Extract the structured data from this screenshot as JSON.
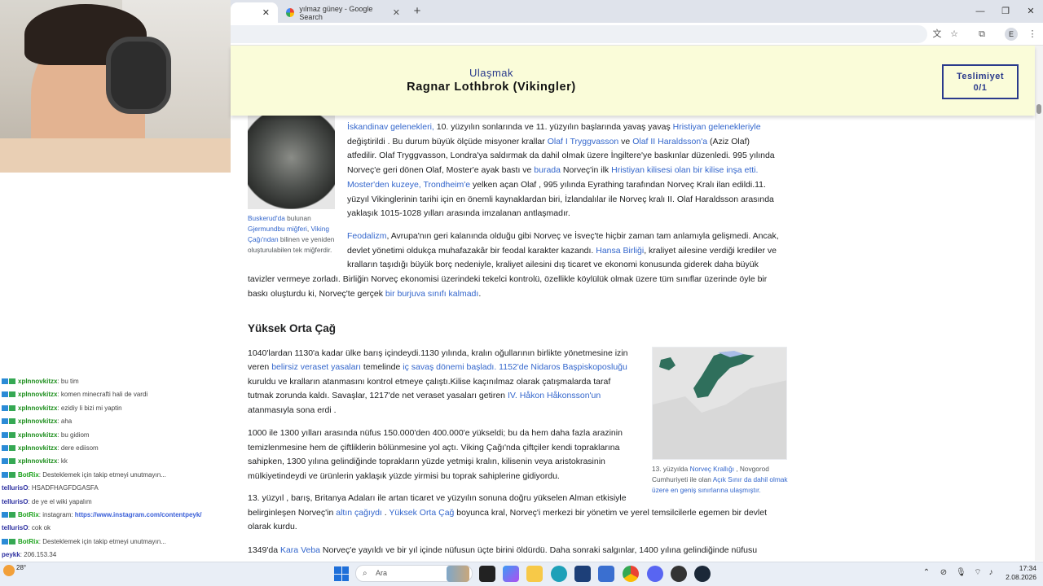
{
  "browser": {
    "tabs": [
      {
        "label": ""
      },
      {
        "label": "yılmaz güney - Google Search"
      }
    ],
    "new_tab_icon": "plus-icon",
    "window_controls": [
      "minimize-icon",
      "restore-icon",
      "close-icon"
    ],
    "toolbar_icons": [
      "translate-icon",
      "star-icon",
      "extensions-icon"
    ],
    "profile_initial": "E",
    "menu_icon": "kebab-menu-icon"
  },
  "game": {
    "goal_label": "Ulaşmak",
    "target_title": "Ragnar Lothbrok (Vikingler)",
    "submission_label": "Teslimiyet",
    "submission_count": "0/1"
  },
  "article": {
    "intro_lines": [
      [
        "",
        "İskandinav gelenekleri,",
        " 10. yüzyılın sonlarında ve 11. yüzyılın başlarında yavaş yavaş ",
        "Hristiyan gelenekleriyle"
      ],
      [
        "değiştirildi . Bu durum büyük ölçüde misyoner krallar ",
        "Olaf I Tryggvasson",
        " ve ",
        "Olaf II Haraldsson'a",
        " (Aziz Olaf)"
      ],
      [
        "atfedilir. Olaf Tryggvasson, Londra'ya saldırmak da dahil olmak üzere İngiltere'ye baskınlar düzenledi. 995 yılında"
      ],
      [
        "Norveç'e geri dönen Olaf, Moster'e ayak bastı ve ",
        "burada",
        " Norveç'in ilk ",
        "Hristiyan kilisesi olan bir kilise inşa etti."
      ],
      [
        "",
        "Moster'den kuzeye, Trondheim'e",
        " yelken açan Olaf , 995 yılında Eyrathing tarafından Norveç Kralı ilan edildi.11."
      ],
      [
        "yüzyıl Vikinglerinin tarihi için en önemli kaynaklardan biri, İzlandalılar ile Norveç kralı II. Olaf Haraldsson arasında"
      ],
      [
        "yaklaşık 1015-1028 yılları arasında imzalanan antlaşmadır."
      ]
    ],
    "helmet_caption": {
      "parts": [
        "Buskerud'da",
        " bulunan ",
        "Gjermundbu miğferi",
        ", ",
        "Viking Çağı'ndan",
        " bilinen ve yeniden oluşturulabilen tek miğferdir."
      ]
    },
    "feudal_lines": [
      [
        "",
        "Feodalizm",
        ", Avrupa'nın geri kalanında olduğu gibi Norveç ve İsveç'te hiçbir zaman tam anlamıyla gelişmedi. Ancak,"
      ],
      [
        "devlet yönetimi oldukça muhafazakâr bir feodal karakter kazandı. ",
        "Hansa Birliği",
        ", kraliyet ailesine verdiği krediler ve"
      ],
      [
        "kralların taşıdığı büyük borç nedeniyle, kraliyet ailesini dış ticaret ve ekonomi konusunda giderek daha büyük"
      ],
      [
        "tavizler vermeye zorladı. Birliğin Norveç ekonomisi üzerindeki tekelci kontrolü, özellikle köylülük olmak üzere tüm sınıflar üzerinde öyle bir"
      ],
      [
        "baskı oluşturdu ki, Norveç'te gerçek ",
        "bir burjuva sınıfı kalmadı",
        "."
      ]
    ],
    "section_heading": "Yüksek Orta Çağ",
    "high_lines": [
      [
        "1040'lardan 1130'a kadar ülke barış içindeydi.1130 yılında, kralın oğullarının birlikte yönetmesine izin"
      ],
      [
        "veren ",
        "belirsiz veraset yasaları",
        " temelinde ",
        "iç savaş dönemi başladı. 1152'de Nidaros Başpiskoposluğu"
      ],
      [
        "kuruldu ve kralların atanmasını kontrol etmeye çalıştı.Kilise kaçınılmaz olarak çatışmalarda taraf"
      ],
      [
        "tutmak zorunda kaldı. Savaşlar, 1217'de net veraset yasaları getiren ",
        "IV. Håkon Håkonsson'un"
      ],
      [
        "atanmasıyla sona erdi ."
      ]
    ],
    "pop_lines": [
      [
        "1000 ile 1300 yılları arasında nüfus 150.000'den 400.000'e yükseldi; bu da hem daha fazla arazinin"
      ],
      [
        "temizlenmesine hem de çiftliklerin bölünmesine yol açtı. Viking Çağı'nda çiftçiler kendi topraklarına"
      ],
      [
        "sahipken, 1300 yılına gelindiğinde toprakların yüzde yetmişi kralın, kilisenin veya aristokrasinin"
      ],
      [
        "mülkiyetindeydi ve ürünlerin yaklaşık yüzde yirmisi bu toprak sahiplerine gidiyordu."
      ]
    ],
    "map_caption": {
      "parts": [
        "13. yüzyılda ",
        "Norveç Krallığı",
        " , Novgorod Cumhuriyeti ile olan ",
        "Açık Sınır da dahil olmak üzere en geniş sınırlarına ulaşmıştır."
      ]
    },
    "c13_lines": [
      [
        "13. yüzyıl , barış, Britanya Adaları ile artan ticaret ve yüzyılın sonuna doğru yükselen Alman etkisiyle"
      ],
      [
        "belirginleşen Norveç'in ",
        "altın çağıydı",
        " . ",
        "Yüksek Orta Çağ",
        " boyunca kral, Norveç'i merkezi bir yönetim ve yerel temsilcilerle egemen bir devlet"
      ],
      [
        "olarak kurdu."
      ]
    ],
    "plague_lines": [
      [
        "1349'da ",
        "Kara Veba",
        " Norveç'e yayıldı ve bir yıl içinde nüfusun üçte birini öldürdü. Daha sonraki salgınlar, 1400 yılına gelindiğinde nüfusu"
      ]
    ]
  },
  "chat": {
    "messages": [
      {
        "user": "xpInnovkitzx",
        "text": ": bu tim"
      },
      {
        "user": "xpInnovkitzx",
        "text": ": komen minecrafti hali de vardi"
      },
      {
        "user": "xpInnovkitzx",
        "text": ": ezidiy li bizi mi yaptin"
      },
      {
        "user": "xpInnovkitzx",
        "text": ": aha"
      },
      {
        "user": "xpInnovkitzx",
        "text": ": bu gidiom"
      },
      {
        "user": "xpInnovkitzx",
        "text": ": dere ediisom"
      },
      {
        "user": "xpInnovkitzx",
        "text": ": kk"
      },
      {
        "user": "BotRix",
        "text": ": Desteklemek için takip etmeyi unutmayın..."
      },
      {
        "user": "tellurisO",
        "text": ": HSADFHAGFDGASFA"
      },
      {
        "user": "tellurisO",
        "text": ": de ye el wiki yapalım"
      },
      {
        "user": "BotRix",
        "text": ": instagram: ",
        "link": "https://www.instagram.com/contentpeyk/"
      },
      {
        "user": "tellurisO",
        "text": ": cok ok"
      },
      {
        "user": "BotRix",
        "text": ": Desteklemek için takip etmeyi unutmayın..."
      },
      {
        "user": "peykk",
        "text": ": 206.153.34"
      },
      {
        "user": "BotRix",
        "text": ": Desteklemek için takip etmeyi unutmayın..."
      }
    ]
  },
  "taskbar": {
    "search_placeholder": "Ara",
    "time": "17:34",
    "date": "2.08.2026",
    "weather_temp": "28°"
  },
  "colors": {
    "link": "#3366cc",
    "sticky_bg": "#fafcd9",
    "accent": "#2a3a8c"
  }
}
